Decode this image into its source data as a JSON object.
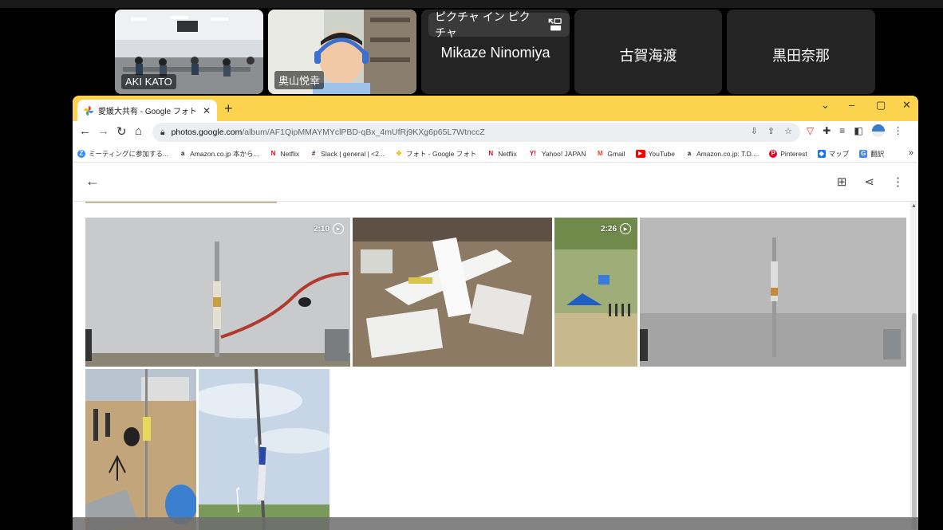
{
  "participants": [
    {
      "name": "AKI KATO",
      "kind": "video-classroom"
    },
    {
      "name": "奥山悦幸",
      "kind": "video-person"
    },
    {
      "name": "Mikaze Ninomiya",
      "kind": "name-only",
      "pip_label": "ピクチャ イン ピクチャ"
    },
    {
      "name": "古賀海渡",
      "kind": "name-only"
    },
    {
      "name": "黒田奈那",
      "kind": "name-only"
    }
  ],
  "browser": {
    "tab_title": "愛媛大共有 - Google フォト",
    "url_host": "photos.google.com",
    "url_path": "/album/AF1QipMMAYMYclPBD-qBx_4mUfRj9KXg6p65L7WtnccZ",
    "bookmarks": [
      {
        "label": "ミーティングに参加する...",
        "icon": "zoom-icon",
        "color": "#2d8cff"
      },
      {
        "label": "Amazon.co.jp 本から...",
        "icon": "amazon-icon",
        "color": "#222"
      },
      {
        "label": "Netflix",
        "icon": "netflix-icon",
        "color": "#e50914"
      },
      {
        "label": "Slack | general | <2...",
        "icon": "slack-icon",
        "color": "#4a154b"
      },
      {
        "label": "フォト - Google フォト",
        "icon": "google-photos-icon",
        "color": "#fbbc04"
      },
      {
        "label": "Netflix",
        "icon": "netflix-icon",
        "color": "#e50914"
      },
      {
        "label": "Yahoo! JAPAN",
        "icon": "yahoo-icon",
        "color": "#ff0033"
      },
      {
        "label": "Gmail",
        "icon": "gmail-icon",
        "color": "#ea4335"
      },
      {
        "label": "YouTube",
        "icon": "youtube-icon",
        "color": "#ff0000"
      },
      {
        "label": "Amazon.co.jp: T.D....",
        "icon": "amazon-icon",
        "color": "#222"
      },
      {
        "label": "Pinterest",
        "icon": "pinterest-icon",
        "color": "#e60023"
      },
      {
        "label": "マップ",
        "icon": "maps-icon",
        "color": "#1a73e8"
      },
      {
        "label": "翻訳",
        "icon": "translate-icon",
        "color": "#4285f4"
      }
    ],
    "more_label": "»"
  },
  "photos": {
    "items": [
      {
        "type": "video",
        "duration": "2:10",
        "scene": "rocket-launch-pad"
      },
      {
        "type": "photo",
        "scene": "model-plane-workbench"
      },
      {
        "type": "video",
        "duration": "2:26",
        "scene": "field-tent"
      },
      {
        "type": "photo",
        "scene": "rocket-liftoff-smoke"
      },
      {
        "type": "photo",
        "scene": "launch-site-ground"
      },
      {
        "type": "photo",
        "scene": "rocket-rail-sky"
      }
    ]
  },
  "colors": {
    "tabstrip": "#fcd34d",
    "tile_bg": "#242424"
  }
}
